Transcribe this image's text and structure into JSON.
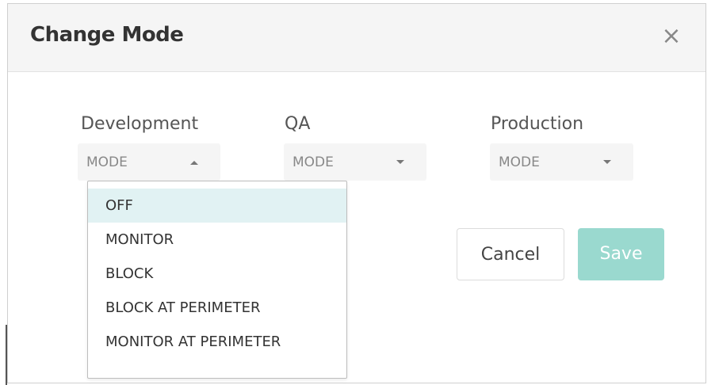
{
  "dialog": {
    "title": "Change Mode",
    "close_glyph": "×"
  },
  "environments": [
    {
      "label": "Development",
      "select_value": "MODE",
      "caret": "up"
    },
    {
      "label": "QA",
      "select_value": "MODE",
      "caret": "down"
    },
    {
      "label": "Production",
      "select_value": "MODE",
      "caret": "down"
    }
  ],
  "dropdown": {
    "options": [
      "OFF",
      "MONITOR",
      "BLOCK",
      "BLOCK AT PERIMETER",
      "MONITOR AT PERIMETER"
    ],
    "highlighted_index": 0
  },
  "buttons": {
    "cancel_label": "Cancel",
    "save_label": "Save"
  },
  "colors": {
    "accent_save": "#9ad9cf",
    "highlight": "#e1f2f3"
  }
}
